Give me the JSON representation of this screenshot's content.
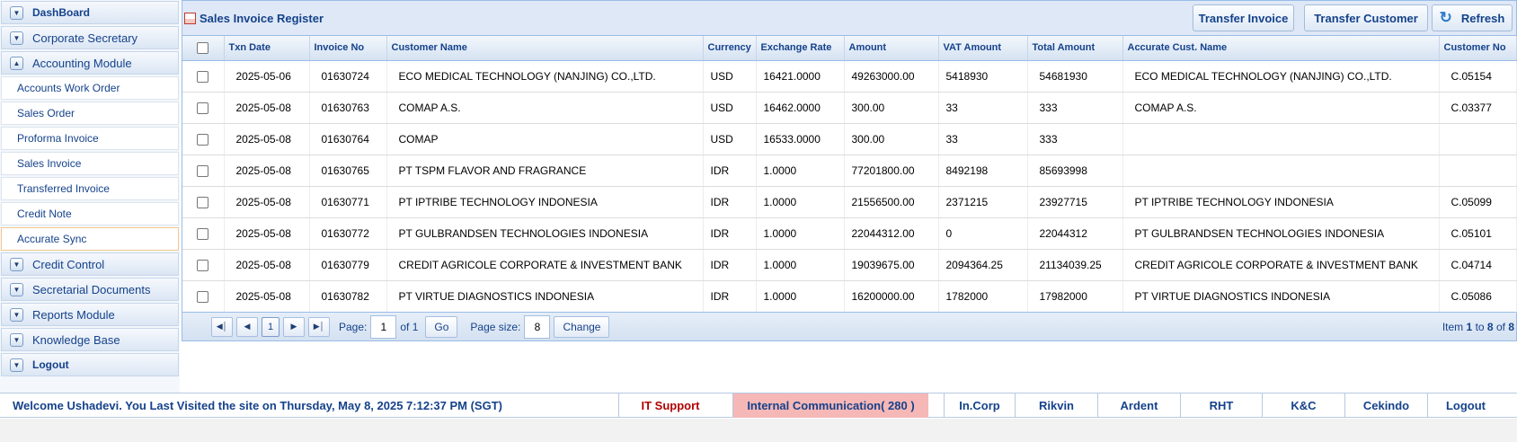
{
  "sidebar": {
    "dashboard": "DashBoard",
    "corporate_secretary": "Corporate Secretary",
    "accounting_module": "Accounting Module",
    "accounting_items": [
      "Accounts Work Order",
      "Sales Order",
      "Proforma Invoice",
      "Sales Invoice",
      "Transferred Invoice",
      "Credit Note",
      "Accurate Sync"
    ],
    "credit_control": "Credit Control",
    "secretarial_documents": "Secretarial Documents",
    "reports_module": "Reports Module",
    "knowledge_base": "Knowledge Base",
    "logout": "Logout"
  },
  "panel": {
    "title": "Sales Invoice Register",
    "transfer_invoice": "Transfer Invoice",
    "transfer_customer": "Transfer Customer",
    "refresh": "Refresh"
  },
  "grid": {
    "columns": [
      "Txn Date",
      "Invoice No",
      "Customer Name",
      "Currency",
      "Exchange Rate",
      "Amount",
      "VAT Amount",
      "Total Amount",
      "Accurate Cust. Name",
      "Customer No"
    ],
    "rows": [
      [
        "2025-05-06",
        "01630724",
        "ECO MEDICAL TECHNOLOGY (NANJING) CO.,LTD.",
        "USD",
        "16421.0000",
        "49263000.00",
        "5418930",
        "54681930",
        "ECO MEDICAL TECHNOLOGY (NANJING) CO.,LTD.",
        "C.05154"
      ],
      [
        "2025-05-08",
        "01630763",
        "COMAP A.S.",
        "USD",
        "16462.0000",
        "300.00",
        "33",
        "333",
        "COMAP A.S.",
        "C.03377"
      ],
      [
        "2025-05-08",
        "01630764",
        "COMAP",
        "USD",
        "16533.0000",
        "300.00",
        "33",
        "333",
        "",
        ""
      ],
      [
        "2025-05-08",
        "01630765",
        "PT TSPM FLAVOR AND FRAGRANCE",
        "IDR",
        "1.0000",
        "77201800.00",
        "8492198",
        "85693998",
        "",
        ""
      ],
      [
        "2025-05-08",
        "01630771",
        "PT IPTRIBE TECHNOLOGY INDONESIA",
        "IDR",
        "1.0000",
        "21556500.00",
        "2371215",
        "23927715",
        "PT IPTRIBE TECHNOLOGY INDONESIA",
        "C.05099"
      ],
      [
        "2025-05-08",
        "01630772",
        "PT GULBRANDSEN TECHNOLOGIES INDONESIA",
        "IDR",
        "1.0000",
        "22044312.00",
        "0",
        "22044312",
        "PT GULBRANDSEN TECHNOLOGIES INDONESIA",
        "C.05101"
      ],
      [
        "2025-05-08",
        "01630779",
        "CREDIT AGRICOLE CORPORATE & INVESTMENT BANK",
        "IDR",
        "1.0000",
        "19039675.00",
        "2094364.25",
        "21134039.25",
        "CREDIT AGRICOLE CORPORATE & INVESTMENT BANK",
        "C.04714"
      ],
      [
        "2025-05-08",
        "01630782",
        "PT VIRTUE DIAGNOSTICS INDONESIA",
        "IDR",
        "1.0000",
        "16200000.00",
        "1782000",
        "17982000",
        "PT VIRTUE DIAGNOSTICS INDONESIA",
        "C.05086"
      ]
    ]
  },
  "pager": {
    "current_page": "1",
    "page_label": "Page:",
    "page_value": "1",
    "of_label": "of 1",
    "go": "Go",
    "page_size_label": "Page size:",
    "page_size_value": "8",
    "change": "Change",
    "item_prefix": "Item",
    "item_from": "1",
    "item_to_label": "to",
    "item_to": "8",
    "item_of_label": "of",
    "item_total": "8"
  },
  "footer": {
    "welcome": "Welcome Ushadevi. You Last Visited the site on Thursday, May 8, 2025 7:12:37 PM (SGT)",
    "it_support": "IT Support",
    "internal_communication": "Internal Communication( 280 )",
    "links": [
      "In.Corp",
      "Rikvin",
      "Ardent",
      "RHT",
      "K&C",
      "Cekindo",
      "Logout"
    ]
  },
  "icons": {
    "collapse": "chevron-down-icon",
    "expand": "chevron-up-icon",
    "refresh": "refresh-icon",
    "document": "document-icon",
    "pager": [
      "first-page-icon",
      "prev-page-icon",
      "next-page-icon",
      "last-page-icon"
    ]
  }
}
